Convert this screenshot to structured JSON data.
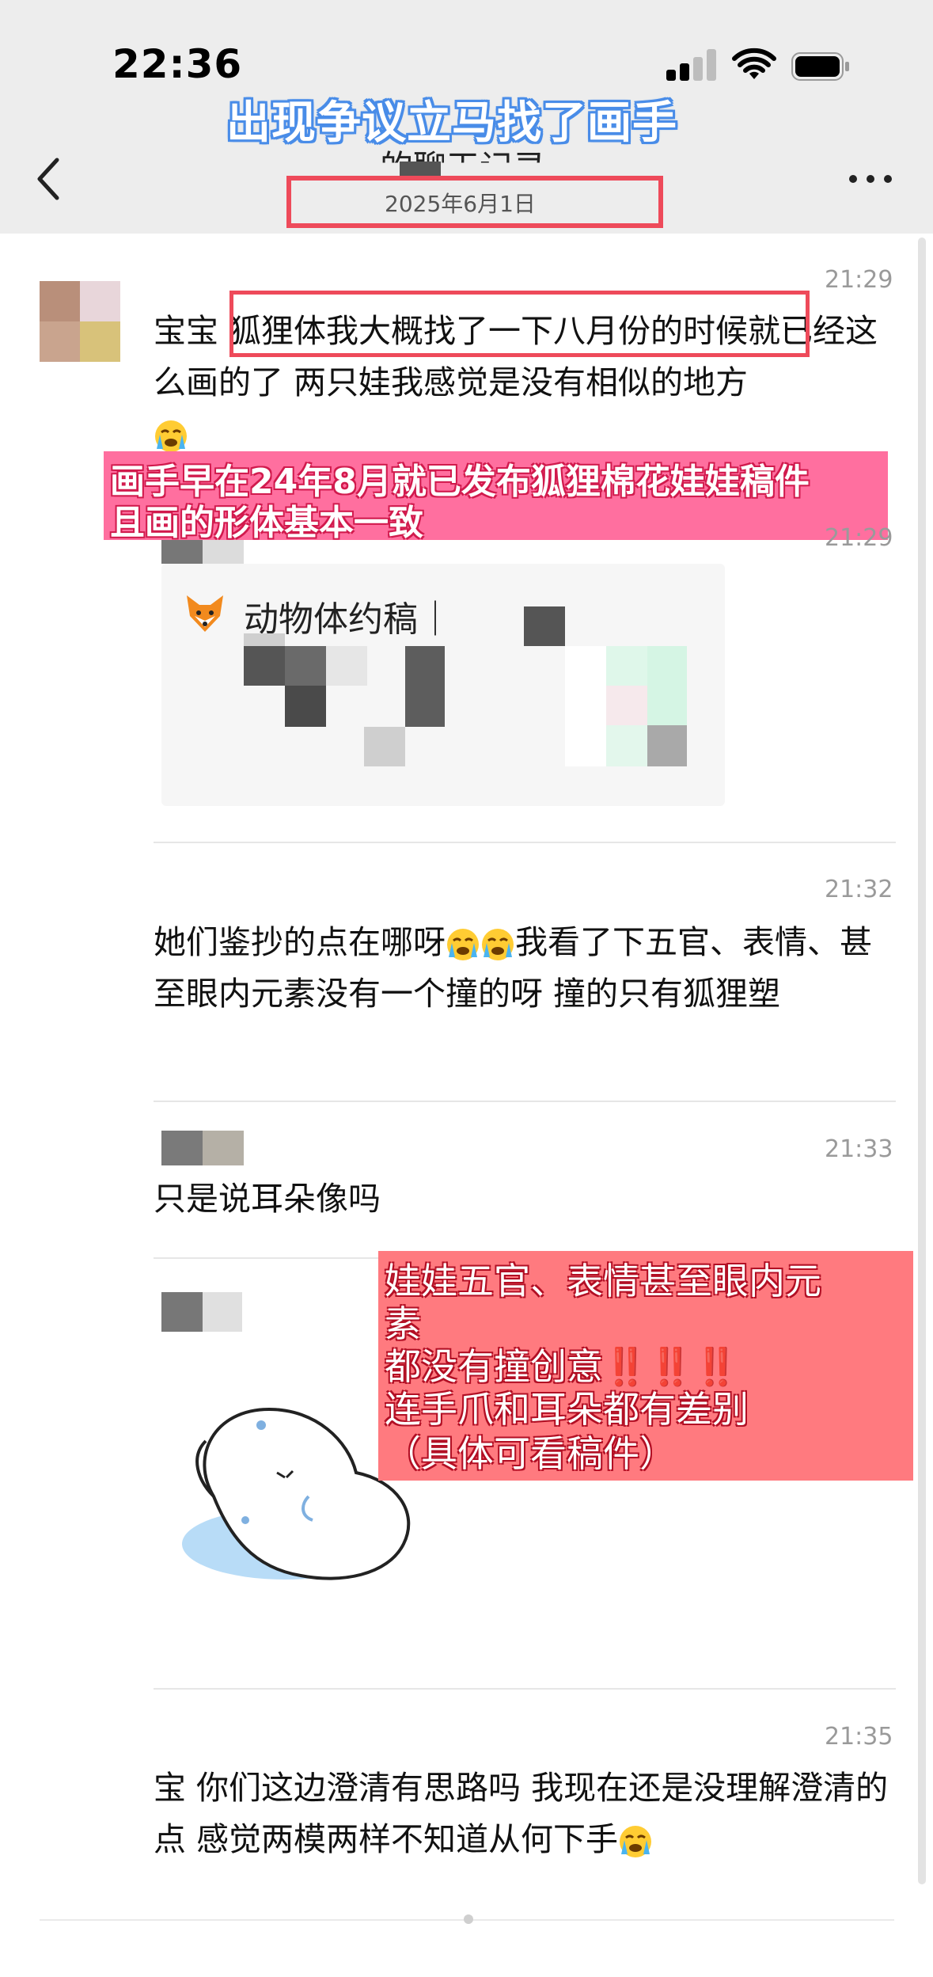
{
  "status_bar": {
    "time": "22:36"
  },
  "overlay": {
    "title": "出现争议立马找了画手"
  },
  "nav": {
    "title": "的聊天记录",
    "date": "2025年6月1日"
  },
  "messages": [
    {
      "time": "21:29",
      "text_before": "宝宝 ",
      "text_highlight": "狐狸体我大概找了一下八月份的时候",
      "text_after": "就已经这么画的了 两只娃我感觉是没有相似的地方"
    },
    {
      "time": "21:29"
    },
    {
      "time": "21:32",
      "text": "她们鉴抄的点在哪呀",
      "text_after": "我看了下五官、表情、甚至眼内元素没有一个撞的呀 撞的只有狐狸塑"
    },
    {
      "time": "21:33",
      "text": "只是说耳朵像吗"
    },
    {
      "time": "21:35",
      "text": "宝 你们这边澄清有思路吗 我现在还是没理解澄清的点 感觉两模两样不知道从何下手"
    }
  ],
  "card": {
    "title": "动物体约稿｜"
  },
  "annotations": {
    "pink": [
      "画手早在24年8月就已发布狐狸棉花娃娃稿件",
      "且画的形体基本一致"
    ],
    "red": [
      "娃娃五官、表情甚至眼内元",
      "素",
      "都没有撞创意",
      "连手爪和耳朵都有差别",
      "（具体可看稿件）"
    ],
    "red_bang": "‼️‼️‼️"
  },
  "icons": {
    "back": "chevron-left-icon",
    "more": "more-dots-icon",
    "signal": "cellular-signal-icon",
    "wifi": "wifi-icon",
    "battery": "battery-icon",
    "emoji": "loudly-crying-face-emoji",
    "fox": "fox-face-emoji"
  },
  "colors": {
    "nav_bg": "#ededed",
    "highlight_red": "#ee4a5a",
    "pink_banner": "#ff6f9f",
    "red_banner": "#ff7a7f",
    "title_blue": "#4a8de8"
  }
}
